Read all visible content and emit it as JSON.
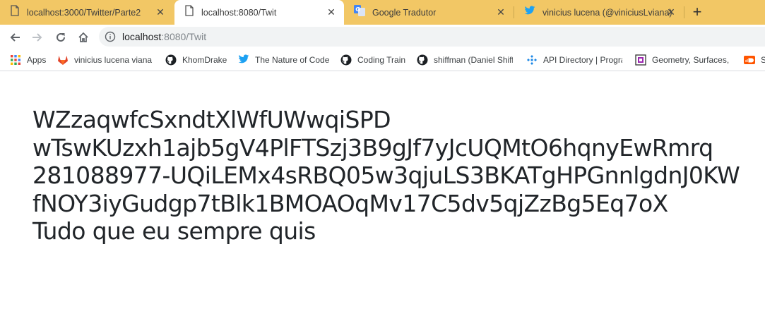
{
  "tabs": [
    {
      "title": "localhost:3000/Twitter/Parte2",
      "icon": "page-icon"
    },
    {
      "title": "localhost:8080/Twit",
      "icon": "page-icon",
      "active": true
    },
    {
      "title": "Google Tradutor",
      "icon": "google-translate-icon"
    },
    {
      "title": "vinicius lucena (@viniciusLviana)",
      "icon": "twitter-icon"
    }
  ],
  "address_bar": {
    "host": "localhost",
    "path": ":8080/Twit"
  },
  "bookmarks": [
    {
      "label": "Apps",
      "icon": "apps-grid-icon"
    },
    {
      "label": "vinicius lucena viana /",
      "icon": "gitlab-icon"
    },
    {
      "label": "KhomDrake",
      "icon": "github-icon"
    },
    {
      "label": "The Nature of Code",
      "icon": "twitter-icon"
    },
    {
      "label": "Coding Train",
      "icon": "github-icon"
    },
    {
      "label": "shiffman (Daniel Shiffman)",
      "icon": "github-icon"
    },
    {
      "label": "API Directory | ProgrammableWeb",
      "icon": "puzzle-icon"
    },
    {
      "label": "Geometry, Surfaces, Curves",
      "icon": "geometry-icon"
    },
    {
      "label": "SoundCloud",
      "icon": "soundcloud-icon"
    }
  ],
  "content": {
    "lines": [
      "WZzaqwfcSxndtXlWfUWwqiSPD",
      "wTswKUzxh1ajb5gV4PlFTSzj3B9gJf7yJcUQMtO6hqnyEwRmrq",
      "281088977-UQiLEMx4sRBQ05w3qjuLS3BKATgHPGnnlgdnJ0KW",
      "fNOY3iyGudgp7tBlk1BMOAOqMv17C5dv5qjZzBg5Eq7oX",
      "Tudo que eu sempre quis"
    ]
  },
  "colors": {
    "tab_strip": "#f2c765",
    "text": "#212529",
    "twitter_blue": "#1da1f2",
    "gitlab_orange": "#e24329",
    "soundcloud_orange": "#ff5500"
  }
}
